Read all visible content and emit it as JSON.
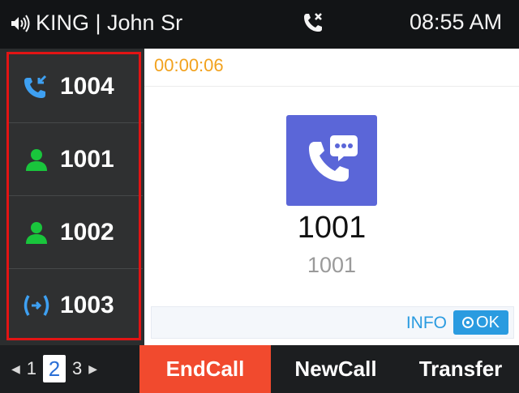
{
  "status_bar": {
    "account_label": "KING | John Sr",
    "time": "08:55 AM",
    "icons": [
      "speaker-icon",
      "missed-call-icon"
    ]
  },
  "lines": [
    {
      "number": "1004",
      "icon": "incoming-call-icon",
      "icon_color": "#3ea0f2"
    },
    {
      "number": "1001",
      "icon": "contact-person-icon",
      "icon_color": "#19c53c"
    },
    {
      "number": "1002",
      "icon": "contact-person-icon",
      "icon_color": "#19c53c"
    },
    {
      "number": "1003",
      "icon": "conference-call-icon",
      "icon_color": "#3ea0f2"
    }
  ],
  "call": {
    "timer": "00:00:06",
    "contact_name": "1001",
    "contact_number": "1001",
    "info_label": "INFO",
    "ok_label": "OK"
  },
  "pager": {
    "prev": "1",
    "current": "2",
    "next": "3"
  },
  "softkeys": {
    "end_call": "EndCall",
    "new_call": "NewCall",
    "transfer": "Transfer"
  },
  "colors": {
    "accent_blue": "#2a9be0",
    "endcall_red": "#f14a2e",
    "timer_orange": "#f2a21e",
    "highlight_red": "#e31414",
    "contact_tile": "#5b66d8"
  }
}
